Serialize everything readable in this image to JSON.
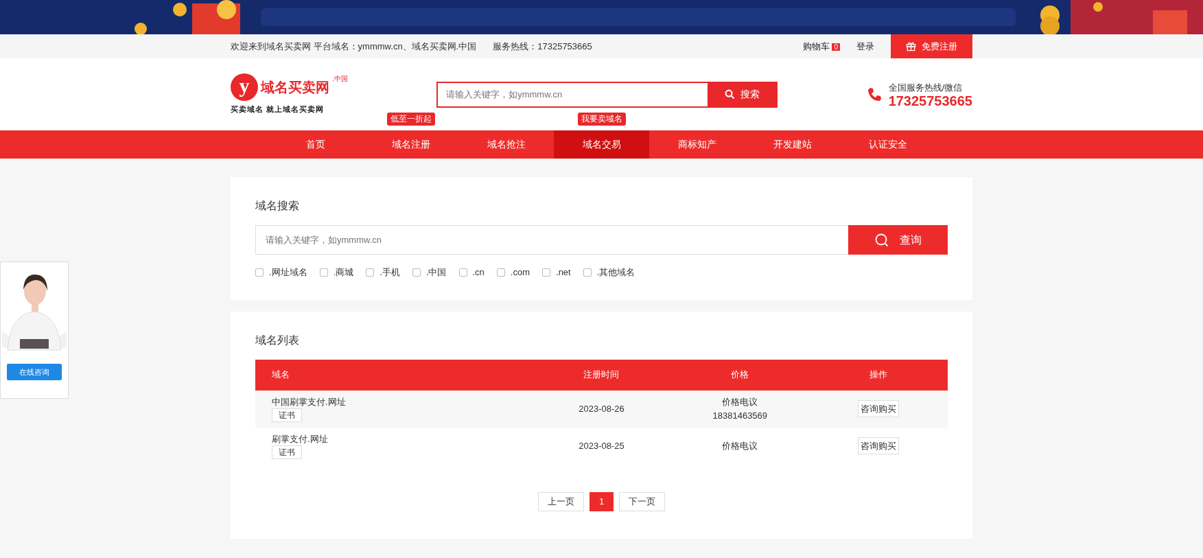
{
  "top_bar": {
    "welcome": "欢迎来到域名买卖网 平台域名：ymmmw.cn、域名买卖网.中国",
    "hotline": "服务热线：17325753665",
    "cart": {
      "label": "购物车",
      "count": "0"
    },
    "login": "登录",
    "register": "免费注册"
  },
  "header": {
    "logo": {
      "mark": "y",
      "name": "域名买卖网",
      "suffix": ".中国",
      "slogan": "买卖域名 就上域名买卖网"
    },
    "search": {
      "placeholder": "请输入关键字，如ymmmw.cn",
      "button": "搜索"
    },
    "hotline": {
      "label": "全国服务热线/微信",
      "number": "17325753665"
    }
  },
  "nav": [
    {
      "label": "首页",
      "selected": false
    },
    {
      "label": "域名注册",
      "selected": false,
      "tag": "低至一折起"
    },
    {
      "label": "域名抢注",
      "selected": false
    },
    {
      "label": "域名交易",
      "selected": true,
      "tag": "我要卖域名"
    },
    {
      "label": "商标知产",
      "selected": false
    },
    {
      "label": "开发建站",
      "selected": false
    },
    {
      "label": "认证安全",
      "selected": false
    }
  ],
  "search_panel": {
    "title": "域名搜索",
    "placeholder": "请输入关键字，如ymmmw.cn",
    "button": "查询",
    "filters": [
      {
        "label": ".网址域名",
        "checked": false
      },
      {
        "label": ".商城",
        "checked": false
      },
      {
        "label": ".手机",
        "checked": false
      },
      {
        "label": ".中国",
        "checked": false
      },
      {
        "label": ".cn",
        "checked": false
      },
      {
        "label": ".com",
        "checked": false
      },
      {
        "label": ".net",
        "checked": false
      },
      {
        "label": ".其他域名",
        "checked": false
      }
    ]
  },
  "list_panel": {
    "title": "域名列表",
    "columns": [
      "域名",
      "注册时间",
      "价格",
      "操作"
    ],
    "rows": [
      {
        "domain": "中国刷掌支付.网址",
        "cert": "证书",
        "date": "2023-08-26",
        "price": [
          "价格电议",
          "18381463569"
        ],
        "action": "咨询购买"
      },
      {
        "domain": "刷掌支付.网址",
        "cert": "证书",
        "date": "2023-08-25",
        "price": [
          "价格电议"
        ],
        "action": "咨询购买"
      }
    ],
    "pagination": [
      {
        "label": "上一页",
        "selected": false
      },
      {
        "label": "1",
        "selected": true
      },
      {
        "label": "下一页",
        "selected": false
      }
    ]
  },
  "side_widget": {
    "button": "在线咨询"
  }
}
